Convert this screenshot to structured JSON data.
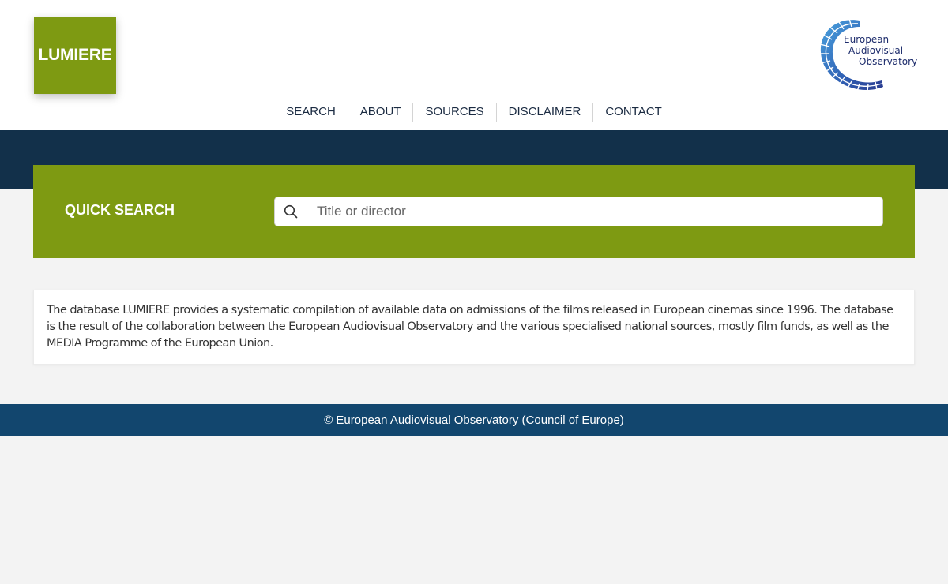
{
  "header": {
    "logo_text": "LUMIERE",
    "observatory_logo": {
      "line1": "European",
      "line2": "Audiovisual",
      "line3": "Observatory"
    }
  },
  "nav": {
    "items": [
      {
        "label": "SEARCH"
      },
      {
        "label": "ABOUT"
      },
      {
        "label": "SOURCES"
      },
      {
        "label": "DISCLAIMER"
      },
      {
        "label": "CONTACT"
      }
    ]
  },
  "quick_search": {
    "label": "QUICK SEARCH",
    "placeholder": "Title or director",
    "value": ""
  },
  "info": {
    "text": "The database LUMIERE provides a systematic compilation of available data on admissions of the films released in European cinemas since 1996. The database is the result of the collaboration between the European Audiovisual Observatory and the various specialised national sources, mostly film funds, as well as the MEDIA Programme of the European Union."
  },
  "footer": {
    "text": "© European Audiovisual Observatory (Council of Europe)"
  },
  "colors": {
    "accent_green": "#7e9a12",
    "dark_navy": "#12304a",
    "footer_blue": "#12466e",
    "page_bg": "#f3f3f3"
  },
  "icons": {
    "search": "search-icon"
  }
}
